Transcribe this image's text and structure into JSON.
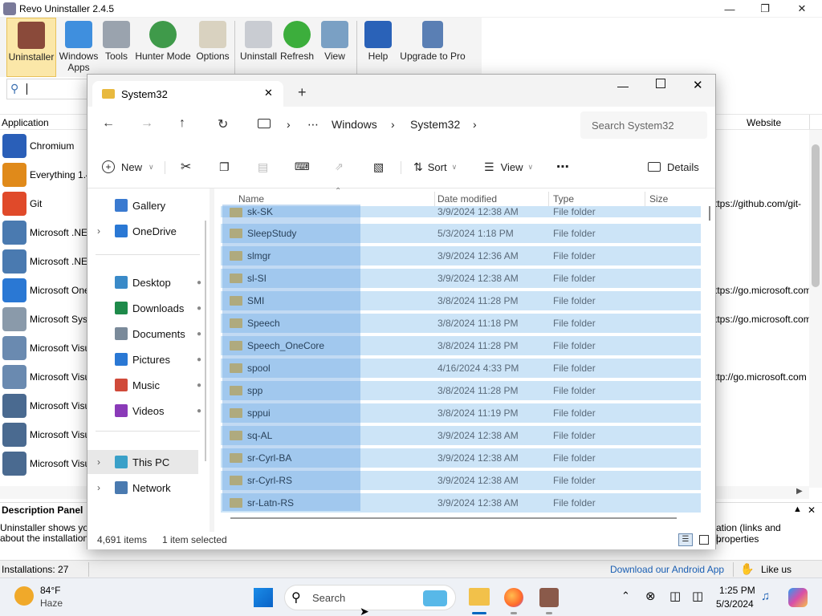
{
  "revo": {
    "title": "Revo Uninstaller 2.4.5",
    "ribbon": [
      {
        "label": "Uninstaller",
        "icon": "uninstaller-icon"
      },
      {
        "label": "Windows Apps",
        "icon": "windows-apps-icon"
      },
      {
        "label": "Tools",
        "icon": "tools-icon"
      },
      {
        "label": "Hunter Mode",
        "icon": "hunter-mode-icon"
      },
      {
        "label": "Options",
        "icon": "options-icon"
      },
      {
        "label": "Uninstall",
        "icon": "uninstall-icon"
      },
      {
        "label": "Refresh",
        "icon": "refresh-icon"
      },
      {
        "label": "View",
        "icon": "view-icon"
      },
      {
        "label": "Help",
        "icon": "help-icon"
      },
      {
        "label": "Upgrade to Pro",
        "icon": "upgrade-icon"
      }
    ],
    "columns": {
      "application": "Application",
      "website": "Website"
    },
    "apps": [
      {
        "name": "Chromium",
        "website": ""
      },
      {
        "name": "Everything 1.4",
        "website": ""
      },
      {
        "name": "Git",
        "website": "ttps://github.com/git-"
      },
      {
        "name": "Microsoft .NE",
        "website": ""
      },
      {
        "name": "Microsoft .NE",
        "website": ""
      },
      {
        "name": "Microsoft One",
        "website": "ttps://go.microsoft.com"
      },
      {
        "name": "Microsoft Syst",
        "website": "ttps://go.microsoft.com"
      },
      {
        "name": "Microsoft Visu",
        "website": ""
      },
      {
        "name": "Microsoft Visu",
        "website": "ttp://go.microsoft.com"
      },
      {
        "name": "Microsoft Visu",
        "website": ""
      },
      {
        "name": "Microsoft Visu",
        "website": ""
      },
      {
        "name": "Microsoft Visu",
        "website": ""
      }
    ],
    "description": {
      "title": "Description Panel",
      "line1": "Uninstaller shows you c",
      "line2": "about the installations)",
      "right1": "ation (links and properties",
      "right2": "l."
    },
    "status": {
      "installations": "Installations: 27",
      "android": "Download our Android App",
      "like": "Like us"
    }
  },
  "explorer": {
    "tab_title": "System32",
    "breadcrumb": [
      "Windows",
      "System32"
    ],
    "search_placeholder": "Search System32",
    "commands": {
      "new": "New",
      "sort": "Sort",
      "view": "View",
      "details": "Details"
    },
    "nav": [
      {
        "label": "Gallery",
        "icon": "gallery-icon",
        "pin": false,
        "expand": false
      },
      {
        "label": "OneDrive",
        "icon": "onedrive-icon",
        "pin": false,
        "expand": true
      },
      {
        "label": "Desktop",
        "icon": "desktop-icon",
        "pin": true,
        "expand": false
      },
      {
        "label": "Downloads",
        "icon": "downloads-icon",
        "pin": true,
        "expand": false
      },
      {
        "label": "Documents",
        "icon": "documents-icon",
        "pin": true,
        "expand": false
      },
      {
        "label": "Pictures",
        "icon": "pictures-icon",
        "pin": true,
        "expand": false
      },
      {
        "label": "Music",
        "icon": "music-icon",
        "pin": true,
        "expand": false
      },
      {
        "label": "Videos",
        "icon": "videos-icon",
        "pin": true,
        "expand": false
      },
      {
        "label": "This PC",
        "icon": "this-pc-icon",
        "pin": false,
        "expand": true
      },
      {
        "label": "Network",
        "icon": "network-icon",
        "pin": false,
        "expand": true
      }
    ],
    "columns": {
      "name": "Name",
      "date": "Date modified",
      "type": "Type",
      "size": "Size"
    },
    "files": [
      {
        "name": "sk-SK",
        "date": "3/9/2024 12:38 AM",
        "type": "File folder"
      },
      {
        "name": "SleepStudy",
        "date": "5/3/2024 1:18 PM",
        "type": "File folder"
      },
      {
        "name": "slmgr",
        "date": "3/9/2024 12:36 AM",
        "type": "File folder"
      },
      {
        "name": "sl-SI",
        "date": "3/9/2024 12:38 AM",
        "type": "File folder"
      },
      {
        "name": "SMI",
        "date": "3/8/2024 11:28 PM",
        "type": "File folder"
      },
      {
        "name": "Speech",
        "date": "3/8/2024 11:18 PM",
        "type": "File folder"
      },
      {
        "name": "Speech_OneCore",
        "date": "3/8/2024 11:28 PM",
        "type": "File folder"
      },
      {
        "name": "spool",
        "date": "4/16/2024 4:33 PM",
        "type": "File folder"
      },
      {
        "name": "spp",
        "date": "3/8/2024 11:28 PM",
        "type": "File folder"
      },
      {
        "name": "sppui",
        "date": "3/8/2024 11:19 PM",
        "type": "File folder"
      },
      {
        "name": "sq-AL",
        "date": "3/9/2024 12:38 AM",
        "type": "File folder"
      },
      {
        "name": "sr-Cyrl-BA",
        "date": "3/9/2024 12:38 AM",
        "type": "File folder"
      },
      {
        "name": "sr-Cyrl-RS",
        "date": "3/9/2024 12:38 AM",
        "type": "File folder"
      },
      {
        "name": "sr-Latn-RS",
        "date": "3/9/2024 12:38 AM",
        "type": "File folder"
      }
    ],
    "status": {
      "items": "4,691 items",
      "selected": "1 item selected"
    }
  },
  "taskbar": {
    "weather": {
      "temp": "84°F",
      "cond": "Haze"
    },
    "search": "Search",
    "time": "1:25 PM",
    "date": "5/3/2024"
  },
  "colors": {
    "selection": "#cce4f7",
    "selection_strong": "#99c9ef",
    "accent": "#0067c0",
    "folder": "#e2b54c"
  }
}
